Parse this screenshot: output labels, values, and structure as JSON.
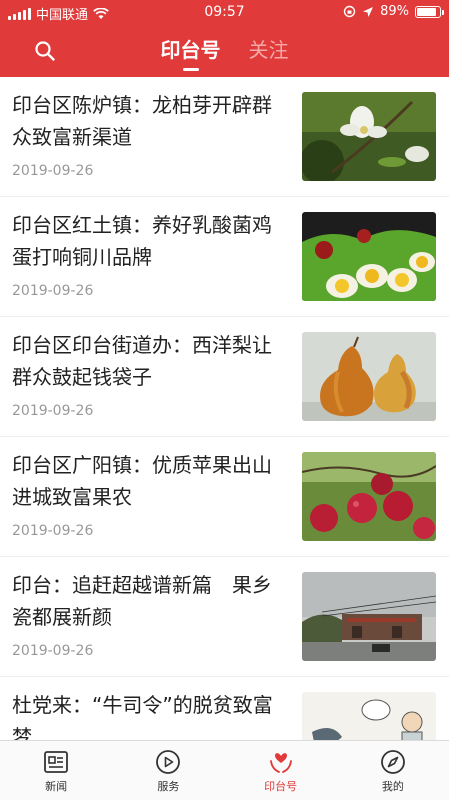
{
  "status_bar": {
    "carrier": "中国联通",
    "time": "09:57",
    "battery": "89%",
    "battery_level": 0.89
  },
  "header": {
    "tabs": [
      {
        "label": "印台号",
        "active": true
      },
      {
        "label": "关注",
        "active": false
      }
    ]
  },
  "feed": {
    "items": [
      {
        "title": "印台区陈炉镇：龙柏芽开辟群众致富新渠道",
        "date": "2019-09-26",
        "image": "white-blossom-photo"
      },
      {
        "title": "印台区红土镇：养好乳酸菌鸡蛋打响铜川品牌",
        "date": "2019-09-26",
        "image": "eggs-and-tomato-photo"
      },
      {
        "title": "印台区印台街道办：西洋梨让群众鼓起钱袋子",
        "date": "2019-09-26",
        "image": "pears-photo"
      },
      {
        "title": "印台区广阳镇：优质苹果出山进城致富果农",
        "date": "2019-09-26",
        "image": "red-apples-photo"
      },
      {
        "title": "印台：追赶超越谱新篇　果乡瓷都展新颜",
        "date": "2019-09-26",
        "image": "village-street-photo"
      },
      {
        "title": "杜党来：“牛司令”的脱贫致富梦",
        "date": "",
        "image": "cartoon-illustration"
      }
    ]
  },
  "tabbar": {
    "items": [
      {
        "label": "新闻",
        "icon": "newspaper-icon"
      },
      {
        "label": "服务",
        "icon": "play-circle-icon"
      },
      {
        "label": "印台号",
        "icon": "heart-hands-icon",
        "active": true
      },
      {
        "label": "我的",
        "icon": "compass-icon"
      }
    ]
  },
  "colors": {
    "brand_red": "#e03a3a",
    "date_gray": "#999999"
  }
}
